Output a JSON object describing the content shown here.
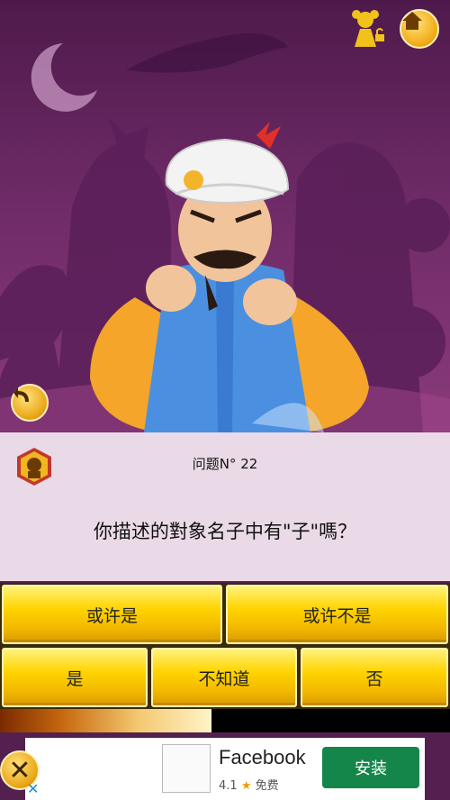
{
  "question": {
    "number": "问题N° 22",
    "text": "你描述的對象名子中有\"子\"嗎？"
  },
  "answers": {
    "probably": "或许是",
    "probably_not": "或许不是",
    "yes": "是",
    "dont_know": "不知道",
    "no": "否"
  },
  "progress": {
    "fraction": 0.47
  },
  "ad": {
    "title": "Facebook",
    "rating": "4.1",
    "price": "免费",
    "install": "安装"
  },
  "colors": {
    "answer_gold": "#ffd400",
    "install_green": "#15864a",
    "scene_purple": "#6d2a66"
  },
  "icons": [
    "home-icon",
    "girl-lock-icon",
    "back-arrow-icon",
    "akinator-badge-icon",
    "close-icon"
  ]
}
